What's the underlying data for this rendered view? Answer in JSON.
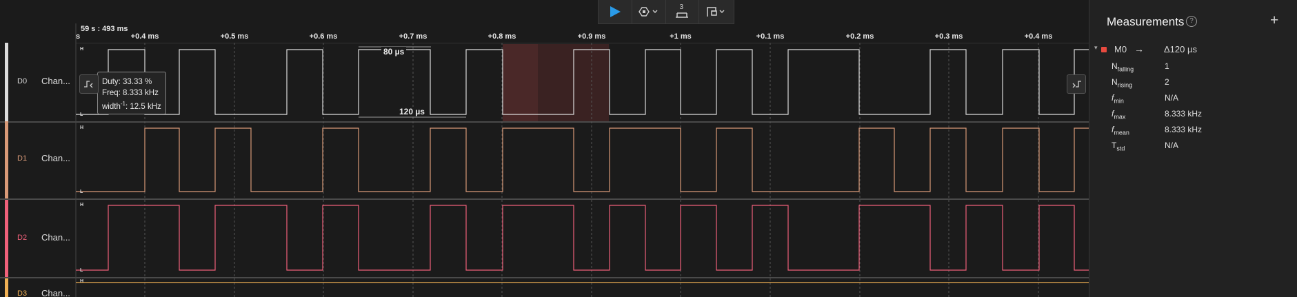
{
  "colors": {
    "d0": "#dcdcdc",
    "d1": "#d99a78",
    "d2": "#f0607a",
    "d3": "#f0b054",
    "accent": "#2a9be8",
    "measure_marker": "#e84a3f"
  },
  "toolbar": {
    "play_icon": "play-icon",
    "trigger_icon": "trigger-icon",
    "capture_icon": "capture-count-icon",
    "capture_count": "3",
    "layout_icon": "layout-icon"
  },
  "ruler": {
    "time": "59 s : 493 ms",
    "ticks": [
      "s",
      "+0.4 ms",
      "+0.5 ms",
      "+0.6 ms",
      "+0.7 ms",
      "+0.8 ms",
      "+0.9 ms",
      "+1 ms",
      "+0.1 ms",
      "+0.2 ms",
      "+0.3 ms",
      "+0.4 ms"
    ]
  },
  "channels": [
    {
      "id": "D0",
      "name": "Chan...",
      "high": "H",
      "low": "L"
    },
    {
      "id": "D1",
      "name": "Chan...",
      "high": "H",
      "low": "L"
    },
    {
      "id": "D2",
      "name": "Chan...",
      "high": "H",
      "low": "L"
    },
    {
      "id": "D3",
      "name": "Chan...",
      "high": "H"
    }
  ],
  "tooltip": {
    "duty": "Duty: 33.33 %",
    "freq": "Freq: 8.333 kHz",
    "width_prefix": "width",
    "width_sup": "-1",
    "width_value": ": 12.5 kHz"
  },
  "measure_labels": {
    "upper": "80 µs",
    "lower": "120 µs"
  },
  "measurements": {
    "title": "Measurements",
    "marker": "M0",
    "delta": "Δ120 µs",
    "stats": [
      {
        "sym": "N",
        "sub": "falling",
        "value": "1"
      },
      {
        "sym": "N",
        "sub": "rising",
        "value": "2"
      },
      {
        "sym": "f",
        "sub": "min",
        "value": "N/A"
      },
      {
        "sym": "f",
        "sub": "max",
        "value": "8.333 kHz"
      },
      {
        "sym": "f",
        "sub": "mean",
        "value": "8.333 kHz"
      },
      {
        "sym": "T",
        "sub": "std",
        "value": "N/A"
      }
    ]
  }
}
